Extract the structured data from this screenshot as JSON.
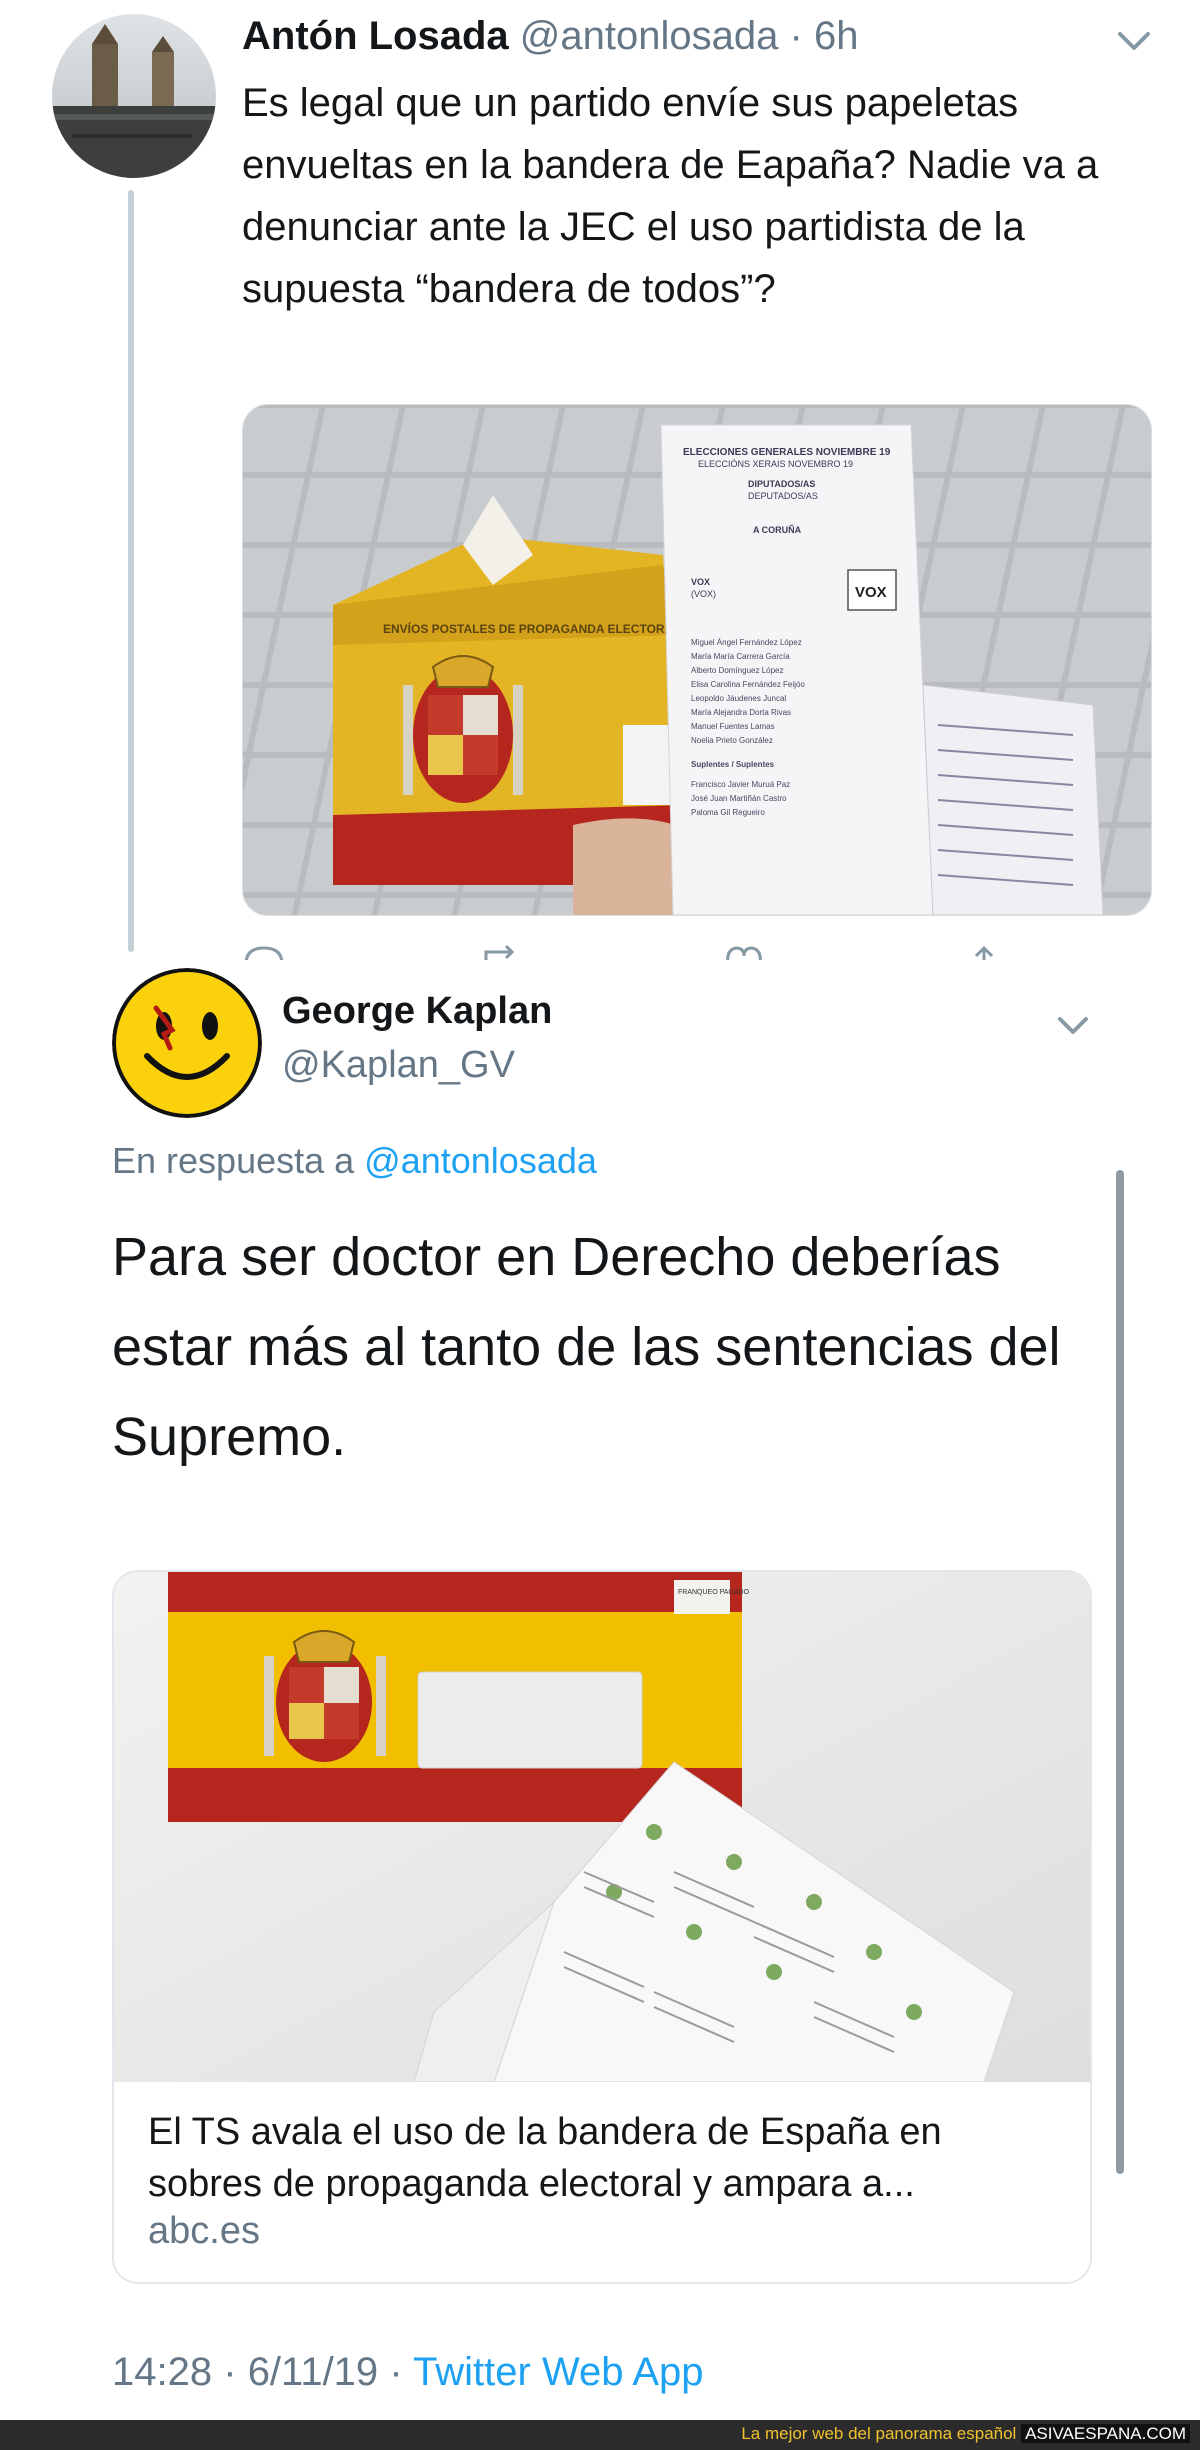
{
  "tweet1": {
    "name": "Antón Losada",
    "handle": "@antonlosada",
    "separator": "·",
    "time": "6h",
    "text": "Es legal que un partido envíe sus papeletas envueltas en la bandera de Eapaña? Nadie va a denunciar ante la JEC el uso partidista de la supuesta “bandera de todos”?",
    "ballot": {
      "header1": "ELECCIONES GENERALES NOVIEMBRE 19",
      "header2": "ELECCIÓNS XERAIS NOVEMBRO 19",
      "header3": "DIPUTADOS/AS",
      "header4": "DEPUTADOS/AS",
      "region": "A CORUÑA",
      "party": "VOX",
      "party_sub": "(VOX)",
      "logo": "VOX",
      "candidates": [
        "Miguel Ángel Fernández López",
        "María María Carrera García",
        "Alberto Domínguez López",
        "Elisa Carolina Fernández Feijóo",
        "Leopoldo Jáudenes Juncal",
        "María Alejandra Dorta Rivas",
        "Manuel Fuentes Lamas",
        "Noelia Prieto González"
      ],
      "suplentes": "Suplentes / Suplentes",
      "suplentes_names": [
        "Francisco Javier Muruá Paz",
        "José Juan Martiñán Castro",
        "Paloma Gil Regueiro"
      ]
    },
    "envelope_label": "ENVÍOS POSTALES DE PROPAGANDA ELECTORAL"
  },
  "tweet2": {
    "name": "George Kaplan",
    "handle": "@Kaplan_GV",
    "reply_prefix": "En respuesta a",
    "reply_to": "@antonlosada",
    "text": "Para ser doctor en Derecho deberías estar más al tanto de las sentencias del Supremo.",
    "card": {
      "title": "El TS avala el uso de la bandera de España en sobres de propaganda electoral y ampara a...",
      "domain": "abc.es",
      "stamp": "FRANQUEO PAGADO"
    },
    "timestamp": {
      "time": "14:28",
      "separator": "·",
      "date": "6/11/19",
      "separator2": "·",
      "source": "Twitter Web App"
    }
  },
  "footer": {
    "tagline": "La mejor web del panorama español",
    "brand": "ASIVAESPANA.COM"
  },
  "colors": {
    "link": "#1da1f2",
    "muted": "#657786",
    "text": "#14171a",
    "flag_red": "#b5261e",
    "flag_yellow": "#f1bf00"
  },
  "icons": [
    "chevron-down-icon",
    "reply-icon",
    "retweet-icon",
    "like-icon",
    "share-icon",
    "smiley-avatar-icon"
  ]
}
